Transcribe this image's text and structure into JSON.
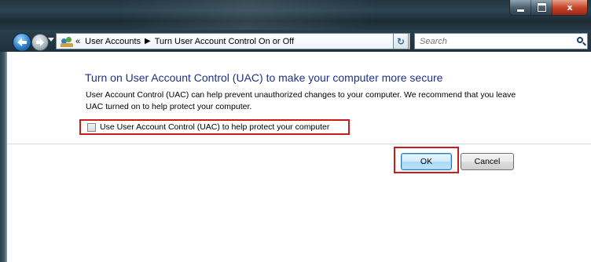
{
  "window": {
    "caption_buttons": [
      "minimize",
      "maximize",
      "close"
    ],
    "close_glyph": "x"
  },
  "nav": {
    "back_icon": "back-arrow-icon",
    "forward_icon": "forward-arrow-icon",
    "address": {
      "prefix": "«",
      "crumbs": [
        "User Accounts",
        "Turn User Account Control On or Off"
      ],
      "separator": "▶"
    },
    "refresh_icon": "refresh-icon",
    "search": {
      "placeholder": "Search"
    }
  },
  "content": {
    "heading": "Turn on User Account Control (UAC) to make your computer more secure",
    "description": "User Account Control (UAC) can help prevent unauthorized changes to your computer.  We recommend that you leave UAC turned on to help protect your computer.",
    "checkbox": {
      "label": "Use User Account Control (UAC) to help protect your computer",
      "checked": false
    }
  },
  "buttons": {
    "ok": "OK",
    "cancel": "Cancel"
  },
  "colors": {
    "heading": "#1e3287",
    "highlight": "#cc1b1b"
  }
}
